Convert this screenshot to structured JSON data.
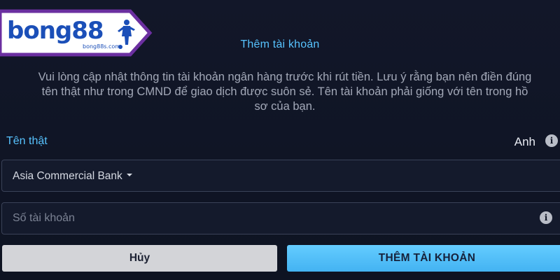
{
  "logo": {
    "brand": "bong88",
    "domain": "bong88s.com"
  },
  "dialog": {
    "title": "Thêm tài khoản",
    "description_lines": [
      "Vui lòng cập nhật thông tin tài khoản ngân hàng trước khi rút tiền. Lưu ý rằng bạn nên điền đúng",
      "tên thật như trong CMND để giao dịch được suôn sẻ. Tên tài khoản phải giống với tên trong hồ",
      "sơ của bạn."
    ],
    "real_name_label": "Tên thật",
    "real_name_value": "Anh",
    "bank_select": {
      "selected": "Asia Commercial Bank"
    },
    "account_number": {
      "placeholder": "Số tài khoản",
      "value": ""
    },
    "buttons": {
      "cancel": "Hủy",
      "add": "THÊM TÀI KHOẢN"
    }
  },
  "colors": {
    "background": "#0f1424",
    "accent": "#57c3ff",
    "primary_button": "#4fbdf8",
    "secondary_button": "#d3d4d8",
    "logo_blue": "#1b4fb8",
    "logo_border": "#6b2fa0"
  },
  "icons": {
    "info": "info-circle-icon",
    "dropdown": "caret-down-icon",
    "player": "football-player-icon"
  }
}
